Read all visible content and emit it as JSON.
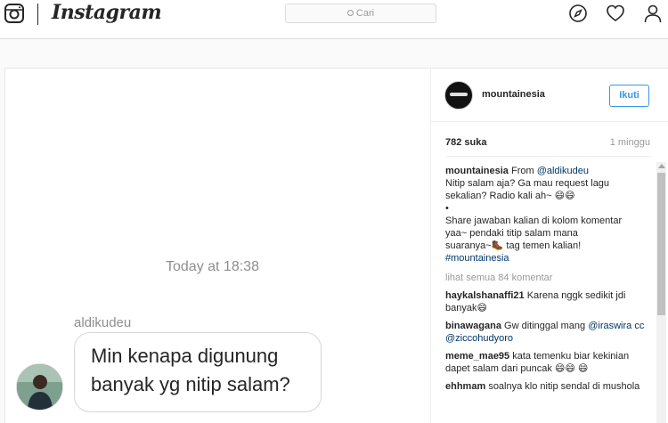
{
  "nav": {
    "wordmark": "Instagram",
    "search_placeholder": "Cari",
    "icons": [
      "instagram-glyph-icon",
      "search-icon",
      "compass-icon",
      "heart-icon",
      "user-icon"
    ]
  },
  "photo": {
    "chat_time": "Today at 18:38",
    "sender": "aldikudeu",
    "message_line1": "Min kenapa digunung",
    "message_line2": "banyak yg nitip salam?"
  },
  "post": {
    "account": "mountainesia",
    "follow_label": "Ikuti",
    "likes": "782 suka",
    "age": "1 minggu",
    "caption": {
      "user": "mountainesia",
      "from_text": "From",
      "mention": "@aldikudeu",
      "line1": "Nitip salam aja? Ga mau request lagu",
      "line2": "sekalian? Radio kali ah~ 😄😄",
      "bullet": "•",
      "line3": "Share jawaban kalian di kolom komentar",
      "line4": "yaa~ pendaki titip salam mana",
      "line5": "suaranya~🥾 tag temen kalian!",
      "hashtag": "#mountainesia"
    },
    "view_all": "lihat semua 84 komentar",
    "comments": [
      {
        "user": "haykalshanaffi21",
        "text": "Karena nggk sedikit jdi banyak😄"
      },
      {
        "user": "binawagana",
        "text": "Gw ditinggal mang",
        "mentions": "@iraswira cc @ziccohudyoro"
      },
      {
        "user": "meme_mae95",
        "text": "kata temenku biar kekinian dapet salam dari puncak 😄😄 😄"
      },
      {
        "user": "ehhmam",
        "text": "soalnya klo nitip sendal di mushola"
      }
    ]
  },
  "colors": {
    "accent": "#3897f0",
    "border": "#dbdbdb",
    "text": "#262626",
    "muted": "#999999"
  }
}
